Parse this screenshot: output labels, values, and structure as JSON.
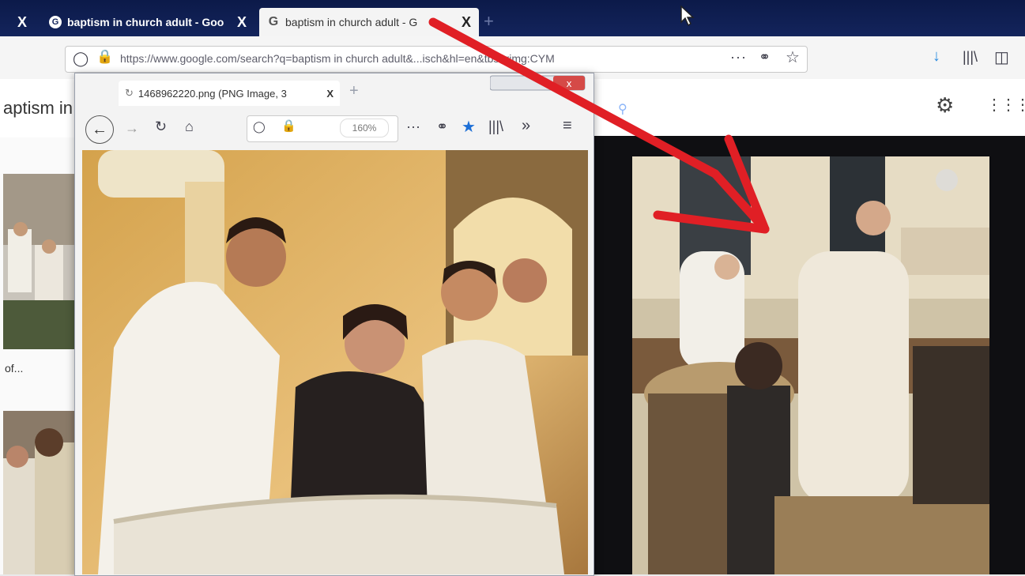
{
  "browser": {
    "tabs": [
      {
        "label": "baptism in church adult - Goo",
        "close": "X"
      },
      {
        "label": "baptism in church adult - G",
        "close": "X"
      }
    ],
    "tab_close_left": "X",
    "url": "https://www.google.com/search?q=baptism in church adult&...isch&hl=en&tbs=rimg:CYM",
    "more_label": "···",
    "new_tab_label": "+"
  },
  "search": {
    "query": "aptism in",
    "more_results_label": "of..."
  },
  "popup": {
    "tab_title": "1468962220.png (PNG Image, 3",
    "tab_close": "X",
    "zoom": "160%",
    "more_label": "···",
    "overflow_label": "»"
  },
  "annotation": {
    "arrow_color": "#e01f25"
  },
  "colors": {
    "tabstrip": "#0c1a49",
    "accent": "#e01f25"
  }
}
